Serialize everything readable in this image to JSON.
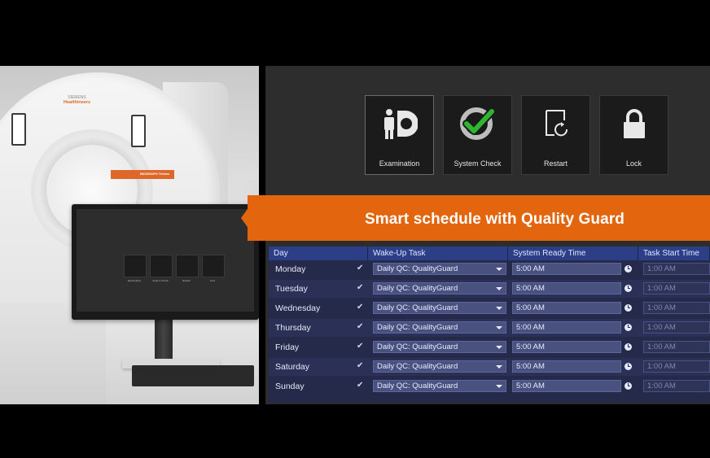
{
  "photo": {
    "scanner_brand": "SIEMENS",
    "scanner_brand_sub": "Healthineers",
    "scanner_model": "BIOGRAPH Trinion",
    "monitor_tiles": [
      "Examination",
      "System Check",
      "Restart",
      "Lock"
    ]
  },
  "menu": {
    "tiles": [
      {
        "label": "Examination",
        "icon": "examination-icon"
      },
      {
        "label": "System Check",
        "icon": "system-check-icon"
      },
      {
        "label": "Restart",
        "icon": "restart-icon"
      },
      {
        "label": "Lock",
        "icon": "lock-icon"
      }
    ]
  },
  "banner": {
    "title": "Smart schedule with Quality Guard",
    "color": "#e3650e"
  },
  "schedule": {
    "headers": [
      "Day",
      "Wake-Up Task",
      "System Ready Time",
      "Task Start Time"
    ],
    "rows": [
      {
        "day": "Monday",
        "task": "Daily QC: QualityGuard",
        "ready": "5:00 AM",
        "start": "1:00 AM"
      },
      {
        "day": "Tuesday",
        "task": "Daily QC: QualityGuard",
        "ready": "5:00 AM",
        "start": "1:00 AM"
      },
      {
        "day": "Wednesday",
        "task": "Daily QC: QualityGuard",
        "ready": "5:00 AM",
        "start": "1:00 AM"
      },
      {
        "day": "Thursday",
        "task": "Daily QC: QualityGuard",
        "ready": "5:00 AM",
        "start": "1:00 AM"
      },
      {
        "day": "Friday",
        "task": "Daily QC: QualityGuard",
        "ready": "5:00 AM",
        "start": "1:00 AM"
      },
      {
        "day": "Saturday",
        "task": "Daily QC: QualityGuard",
        "ready": "5:00 AM",
        "start": "1:00 AM"
      },
      {
        "day": "Sunday",
        "task": "Daily QC: QualityGuard",
        "ready": "5:00 AM",
        "start": "1:00 AM"
      }
    ]
  },
  "colors": {
    "ui_background": "#2d2d2d",
    "header_blue": "#2c3f86",
    "check_green": "#2fb52f"
  }
}
